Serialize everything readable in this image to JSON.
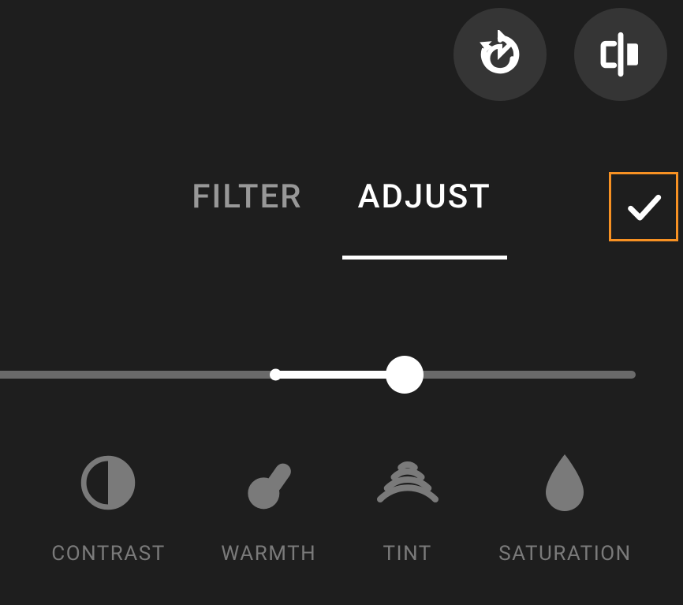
{
  "tabs": {
    "filter": "FILTER",
    "adjust": "ADJUST",
    "active": "adjust"
  },
  "slider": {
    "centerPercent": 40,
    "valuePercent": 59
  },
  "adjustItems": [
    {
      "label": "CONTRAST",
      "icon": "contrast-icon"
    },
    {
      "label": "WARMTH",
      "icon": "warmth-icon"
    },
    {
      "label": "TINT",
      "icon": "tint-icon"
    },
    {
      "label": "SATURATION",
      "icon": "saturation-icon"
    }
  ],
  "colors": {
    "accent": "#f79123",
    "background": "#1e1e1e",
    "buttonBg": "#353535",
    "inactive": "#7a7a7a"
  }
}
